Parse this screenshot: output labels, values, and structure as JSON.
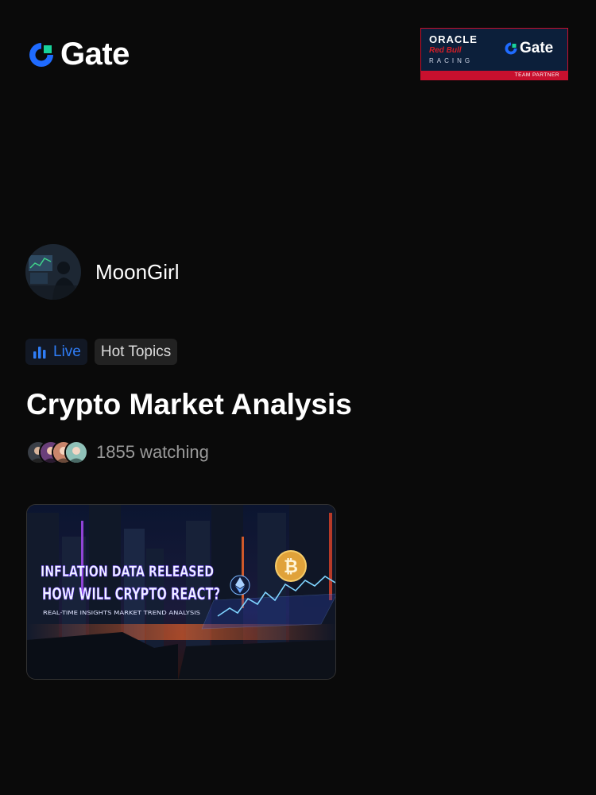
{
  "brand": {
    "name": "Gate",
    "color": "#1f6bff",
    "accent": "#18d39a"
  },
  "partner": {
    "line1": "ORACLE",
    "line2": "Red Bull",
    "line3": "RACING",
    "brand": "Gate",
    "ribbon": "TEAM PARTNER"
  },
  "host": {
    "name": "MoonGirl"
  },
  "tags": {
    "live": "Live",
    "hot": "Hot Topics"
  },
  "stream": {
    "title": "Crypto Market Analysis",
    "watching": "1855 watching"
  },
  "thumbnail": {
    "headline1": "INFLATION DATA RELEASED",
    "headline2": "HOW WILL CRYPTO REACT?",
    "subline": "REAL-TIME INSIGHTS  MARKET TREND ANALYSIS",
    "icons": [
      "bitcoin-coin-icon",
      "ethereum-icon"
    ]
  },
  "colors": {
    "background": "#0a0a0a",
    "live_blue": "#2f7df6",
    "muted_text": "#9a9a9a"
  }
}
